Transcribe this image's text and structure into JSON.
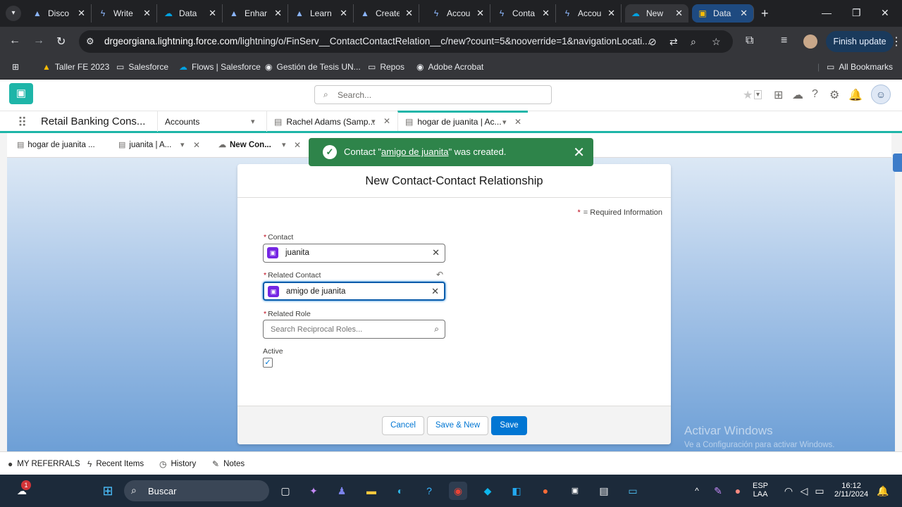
{
  "browser": {
    "tabs": [
      {
        "title": "Disco",
        "icon": "salesforce-trailhead-icon"
      },
      {
        "title": "Write",
        "icon": "lightning-icon"
      },
      {
        "title": "Data",
        "icon": "salesforce-cloud-icon"
      },
      {
        "title": "Enhar",
        "icon": "salesforce-trailhead-icon"
      },
      {
        "title": "Learn",
        "icon": "salesforce-trailhead-icon"
      },
      {
        "title": "Create",
        "icon": "salesforce-trailhead-icon"
      },
      {
        "title": "Accou",
        "icon": "lightning-icon"
      },
      {
        "title": "Conta",
        "icon": "lightning-icon"
      },
      {
        "title": "Accou",
        "icon": "lightning-icon"
      },
      {
        "title": "New",
        "icon": "salesforce-cloud-icon"
      },
      {
        "title": "Data",
        "icon": "data-icon"
      }
    ],
    "url_host": "drgeorgiana.lightning.force.com",
    "url_path": "/lightning/o/FinServ__ContactContactRelation__c/new?count=5&nooverride=1&navigationLocati...",
    "finish_update": "Finish update",
    "bookmarks": [
      "Taller FE 2023",
      "Salesforce",
      "Flows | Salesforce",
      "Gestión de Tesis UN...",
      "Repos",
      "Adobe Acrobat"
    ],
    "all_bookmarks": "All Bookmarks"
  },
  "sf": {
    "search_placeholder": "Search...",
    "app_name": "Retail Banking Cons...",
    "nav": {
      "accounts": "Accounts",
      "tab1": "Rachel Adams (Samp...",
      "tab2": "hogar de juanita | Ac..."
    },
    "subtabs": {
      "t1": "hogar de juanita ...",
      "t2": "juanita | A...",
      "t3": "New Con..."
    },
    "toast": {
      "prefix": "Contact \"",
      "link": "amigo de juanita",
      "suffix": "\" was created."
    },
    "modal": {
      "title": "New Contact-Contact Relationship",
      "required_info": "= Required Information",
      "contact_label": "Contact",
      "contact_value": "juanita",
      "related_contact_label": "Related Contact",
      "related_contact_value": "amigo de juanita",
      "related_role_label": "Related Role",
      "related_role_placeholder": "Search Reciprocal Roles...",
      "active_label": "Active",
      "active_checked": true,
      "cancel": "Cancel",
      "save_new": "Save & New",
      "save": "Save"
    },
    "watermark": {
      "line1": "Activar Windows",
      "line2": "Ve a Configuración para activar Windows."
    },
    "utility": {
      "referrals": "MY REFERRALS",
      "recent": "Recent Items",
      "history": "History",
      "notes": "Notes"
    }
  },
  "taskbar": {
    "search": "Buscar",
    "lang1": "ESP",
    "lang2": "LAA",
    "time": "16:12",
    "date": "2/11/2024",
    "notification_count": "1"
  },
  "colors": {
    "accent": "#1eb5a8",
    "brand_blue": "#0176d3",
    "toast_green": "#2e844a"
  }
}
